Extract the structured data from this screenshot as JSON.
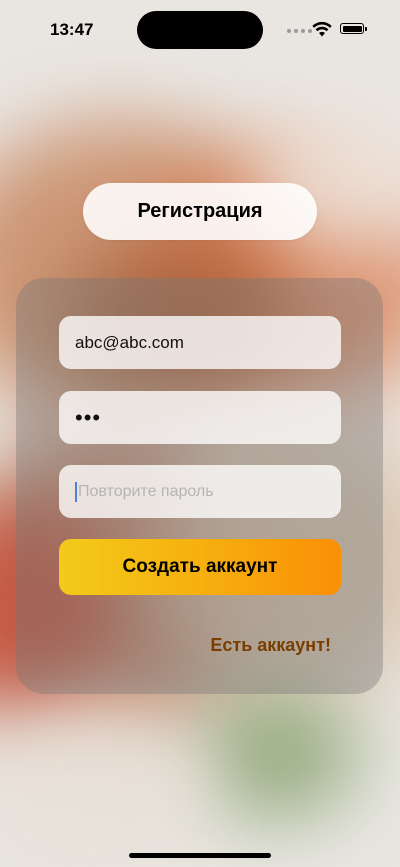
{
  "status_bar": {
    "time": "13:47"
  },
  "header": {
    "title": "Регистрация"
  },
  "form": {
    "email": {
      "value": "abc@abc.com"
    },
    "password": {
      "value": "•••"
    },
    "repeat_password": {
      "value": "",
      "placeholder": "Повторите пароль"
    },
    "create_button_label": "Создать аккаунт",
    "login_link_label": "Есть аккаунт!"
  },
  "colors": {
    "button_gradient_start": "#f3cb1a",
    "button_gradient_end": "#fb8f06",
    "link_color": "#7a3e00"
  }
}
